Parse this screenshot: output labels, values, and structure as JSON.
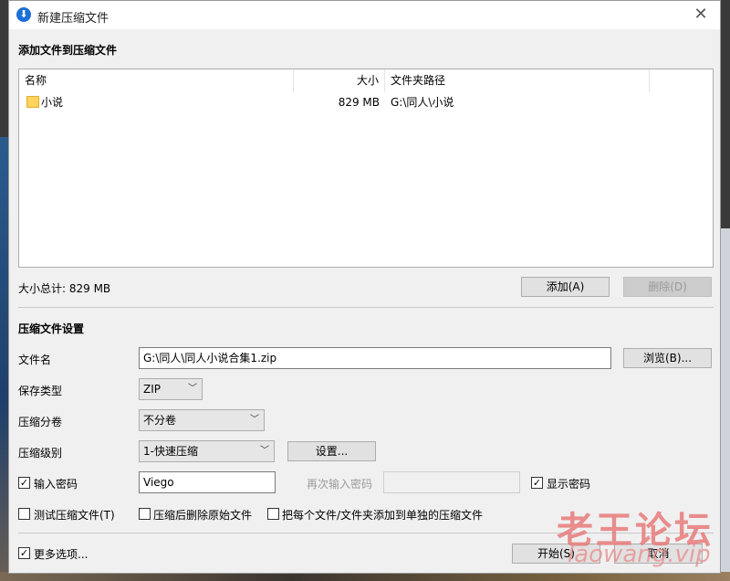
{
  "window": {
    "title": "新建压缩文件",
    "close_glyph": "✕"
  },
  "add_section": {
    "title": "添加文件到压缩文件"
  },
  "file_list": {
    "columns": [
      "名称",
      "大小",
      "文件夹路径"
    ],
    "rows": [
      {
        "name": "小说",
        "size": "829 MB",
        "path": "G:\\同人\\小说"
      }
    ]
  },
  "total": {
    "label": "大小总计: 829 MB"
  },
  "buttons": {
    "add": "添加(A)",
    "delete": "删除(D)",
    "browse": "浏览(B)...",
    "settings": "设置...",
    "start": "开始(S)",
    "cancel": "取消"
  },
  "settings_section": {
    "title": "压缩文件设置"
  },
  "fields": {
    "filename_label": "文件名",
    "filename_value": "G:\\同人\\同人小说合集1.zip",
    "type_label": "保存类型",
    "type_value": "ZIP",
    "split_label": "压缩分卷",
    "split_value": "不分卷",
    "level_label": "压缩级别",
    "level_value": "1-快速压缩",
    "password_label": "输入密码",
    "password_value": "Viego",
    "repeat_label": "再次输入密码",
    "show_password_label": "显示密码"
  },
  "options": {
    "test": "测试压缩文件(T)",
    "delete_after": "压缩后删除原始文件",
    "each_separate": "把每个文件/文件夹添加到单独的压缩文件",
    "more": "更多选项..."
  },
  "checks": {
    "password": true,
    "show_password": true,
    "test": false,
    "delete_after": false,
    "each_separate": false,
    "more": true
  },
  "watermark": {
    "line1": "老王论坛",
    "line2": "laowang.vip"
  },
  "colors": {
    "accent": "#1c6fd6",
    "folder": "#ffd35c",
    "watermark": "#e87b7b"
  }
}
